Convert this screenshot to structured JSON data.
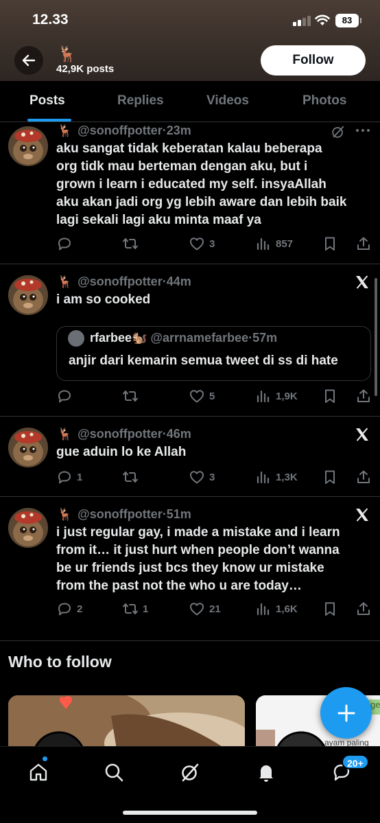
{
  "status_bar": {
    "time": "12.33",
    "battery": "83"
  },
  "header": {
    "emoji": "🦌",
    "post_count": "42,9K posts",
    "follow_label": "Follow"
  },
  "tabs": [
    {
      "label": "Posts",
      "active": true
    },
    {
      "label": "Replies",
      "active": false
    },
    {
      "label": "Videos",
      "active": false
    },
    {
      "label": "Photos",
      "active": false
    }
  ],
  "tweets": [
    {
      "emoji": "🦌",
      "handle": "@sonoffpotter",
      "sep": "·",
      "time": "23m",
      "corner_icon": "grok-icon",
      "lines": [
        "aku sangat tidak keberatan kalau beberapa",
        "org tidk mau berteman dengan aku, but i",
        "grown i learn i educated my self. insyaAllah",
        "aku akan jadi org yg lebih aware dan lebih baik",
        "lagi sekali lagi aku minta maaf ya"
      ],
      "replies": "",
      "reposts": "",
      "likes": "3",
      "views": "857"
    },
    {
      "emoji": "🦌",
      "handle": "@sonoffpotter",
      "sep": "·",
      "time": "44m",
      "corner_icon": "x-logo-icon",
      "lines": [
        "i am so cooked"
      ],
      "quote": {
        "name": "rfarbee🐿️",
        "handle": "@arrnamefarbee",
        "sep": "·",
        "time": "57m",
        "text": "anjir dari kemarin semua tweet di ss di hate"
      },
      "replies": "",
      "reposts": "",
      "likes": "5",
      "views": "1,9K"
    },
    {
      "emoji": "🦌",
      "handle": "@sonoffpotter",
      "sep": "·",
      "time": "46m",
      "corner_icon": "x-logo-icon",
      "lines": [
        "gue aduin lo ke Allah"
      ],
      "replies": "1",
      "reposts": "",
      "likes": "3",
      "views": "1,3K"
    },
    {
      "emoji": "🦌",
      "handle": "@sonoffpotter",
      "sep": "·",
      "time": "51m",
      "corner_icon": "x-logo-icon",
      "lines": [
        "i just regular gay, i made a mistake and i learn",
        "from it… it just hurt when people don’t wanna",
        "be ur friends just bcs they know ur mistake",
        "from the past not the who u are today…"
      ],
      "replies": "2",
      "reposts": "1",
      "likes": "21",
      "views": "1,6K"
    }
  ],
  "who_to_follow": {
    "title": "Who to follow",
    "card2_snippet": "ayam paling",
    "card2_tag": "ge"
  },
  "bottom_nav": {
    "notifications_badge": "20+"
  },
  "colors": {
    "accent": "#1d9bf0",
    "background": "#000000",
    "muted": "#71767b"
  }
}
